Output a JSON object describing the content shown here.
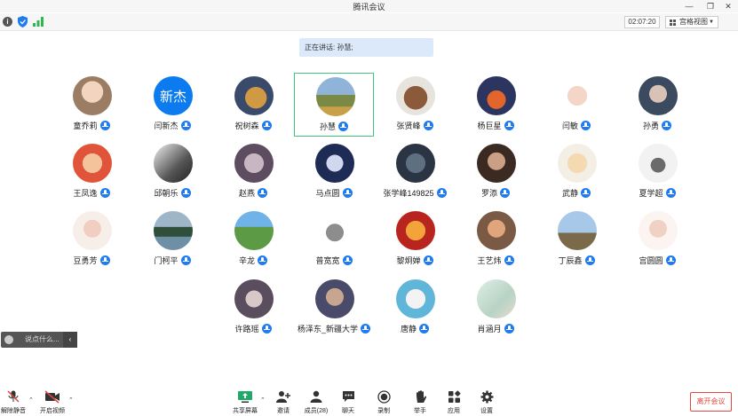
{
  "window": {
    "title": "腾讯会议"
  },
  "status": {
    "timer": "02:07:20",
    "view_label": "宫格视图"
  },
  "banner": {
    "speaking": "正在讲话: 孙慧;"
  },
  "participants": [
    {
      "name": "童乔莉"
    },
    {
      "name": "闫新杰",
      "avatar_text": "新杰"
    },
    {
      "name": "祝树森"
    },
    {
      "name": "孙慧"
    },
    {
      "name": "张贤峰"
    },
    {
      "name": "杨巨星"
    },
    {
      "name": "闫敏"
    },
    {
      "name": "孙勇"
    },
    {
      "name": "王凤逸"
    },
    {
      "name": "邱朝乐"
    },
    {
      "name": "赵燕"
    },
    {
      "name": "马点圆"
    },
    {
      "name": "张学峰149825"
    },
    {
      "name": "罗添"
    },
    {
      "name": "武静"
    },
    {
      "name": "夏学超"
    },
    {
      "name": "豆勇芳"
    },
    {
      "name": "门柯平"
    },
    {
      "name": "辛龙"
    },
    {
      "name": "普宽宽"
    },
    {
      "name": "黎炯婵"
    },
    {
      "name": "王艺炜"
    },
    {
      "name": "丁辰鑫"
    },
    {
      "name": "宫圆圆"
    },
    {
      "name": "许路瑶"
    },
    {
      "name": "杨泽东_新疆大学"
    },
    {
      "name": "唐静"
    },
    {
      "name": "肖涵月"
    }
  ],
  "chat": {
    "placeholder": "说点什么..."
  },
  "toolbar": {
    "unmute": "解除静音",
    "start_video": "开启视频",
    "share": "共享屏幕",
    "invite": "邀请",
    "members": "成员(28)",
    "chat": "聊天",
    "record": "录制",
    "raise_hand": "举手",
    "apps": "应用",
    "settings": "设置",
    "leave": "离开会议"
  },
  "colors": {
    "accent": "#1e7bf0",
    "active_border": "#3ec47b",
    "leave": "#e3483f"
  }
}
